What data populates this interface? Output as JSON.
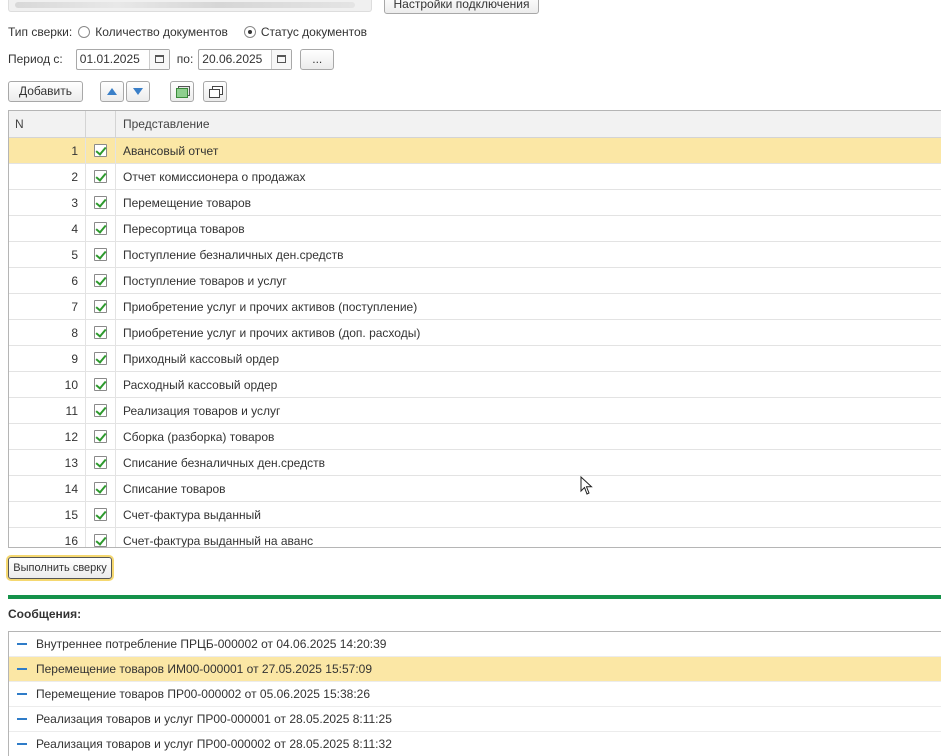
{
  "header": {
    "settings_button": "Настройки подключения"
  },
  "reconcile_type": {
    "label": "Тип сверки:",
    "options": [
      {
        "label": "Количество документов",
        "selected": false
      },
      {
        "label": "Статус документов",
        "selected": true
      }
    ]
  },
  "period": {
    "from_label": "Период с:",
    "from_value": "01.01.2025",
    "to_label": "по:",
    "to_value": "20.06.2025",
    "more_button": "..."
  },
  "toolbar": {
    "add_label": "Добавить",
    "up_icon": "arrow-up-icon",
    "down_icon": "arrow-down-icon",
    "check_all_icon": "check-all-icon",
    "copy_icon": "copy-icon"
  },
  "grid": {
    "columns": {
      "n": "N",
      "name": "Представление"
    },
    "selected_row": 0,
    "rows": [
      {
        "n": "1",
        "name": "Авансовый отчет",
        "checked": true
      },
      {
        "n": "2",
        "name": "Отчет комиссионера о продажах",
        "checked": true
      },
      {
        "n": "3",
        "name": "Перемещение товаров",
        "checked": true
      },
      {
        "n": "4",
        "name": "Пересортица товаров",
        "checked": true
      },
      {
        "n": "5",
        "name": "Поступление безналичных ден.средств",
        "checked": true
      },
      {
        "n": "6",
        "name": "Поступление товаров и услуг",
        "checked": true
      },
      {
        "n": "7",
        "name": "Приобретение услуг и прочих активов (поступление)",
        "checked": true
      },
      {
        "n": "8",
        "name": "Приобретение услуг и прочих активов (доп. расходы)",
        "checked": true
      },
      {
        "n": "9",
        "name": "Приходный кассовый ордер",
        "checked": true
      },
      {
        "n": "10",
        "name": "Расходный кассовый ордер",
        "checked": true
      },
      {
        "n": "11",
        "name": "Реализация товаров и услуг",
        "checked": true
      },
      {
        "n": "12",
        "name": "Сборка (разборка) товаров",
        "checked": true
      },
      {
        "n": "13",
        "name": "Списание безналичных ден.средств",
        "checked": true
      },
      {
        "n": "14",
        "name": "Списание товаров",
        "checked": true
      },
      {
        "n": "15",
        "name": "Счет-фактура выданный",
        "checked": true
      },
      {
        "n": "16",
        "name": "Счет-фактура выданный на аванс",
        "checked": true
      }
    ]
  },
  "run_button": "Выполнить сверку",
  "messages": {
    "title": "Сообщения:",
    "selected_row": 1,
    "items": [
      "Внутреннее потребление ПРЦБ-000002 от 04.06.2025 14:20:39",
      "Перемещение товаров ИМ00-000001 от 27.05.2025 15:57:09",
      "Перемещение товаров ПР00-000002 от 05.06.2025 15:38:26",
      "Реализация товаров и услуг ПР00-000001 от 28.05.2025 8:11:25",
      "Реализация товаров и услуг ПР00-000002 от 28.05.2025 8:11:32"
    ]
  },
  "colors": {
    "selection": "#fbe7a5",
    "divider": "#15924a",
    "check": "#2e9a2e",
    "accent_blue": "#3a7fc8"
  }
}
